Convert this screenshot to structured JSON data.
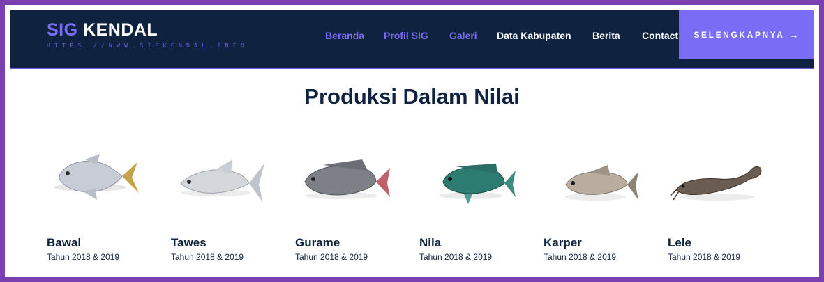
{
  "brand": {
    "title_accent": "SIG",
    "title_rest": "KENDAL",
    "url": "HTTPS://WWW.SIGKENDAL.INFO"
  },
  "nav": {
    "items": [
      {
        "label": "Beranda"
      },
      {
        "label": "Profil SIG"
      },
      {
        "label": "Galeri"
      },
      {
        "label": "Data Kabupaten"
      },
      {
        "label": "Berita"
      },
      {
        "label": "Contact"
      }
    ],
    "cta_label": "SELENGKAPNYA",
    "cta_icon": "arrow-right-icon"
  },
  "colors": {
    "frame": "#7a3fb0",
    "navbar": "#0f2340",
    "accent": "#7b6cf6",
    "text_dark": "#0f2340"
  },
  "main": {
    "heading": "Produksi Dalam Nilai",
    "fish": [
      {
        "name": "Bawal",
        "subtitle": "Tahun 2018 & 2019"
      },
      {
        "name": "Tawes",
        "subtitle": "Tahun 2018 & 2019"
      },
      {
        "name": "Gurame",
        "subtitle": "Tahun 2018 & 2019"
      },
      {
        "name": "Nila",
        "subtitle": "Tahun 2018 & 2019"
      },
      {
        "name": "Karper",
        "subtitle": "Tahun 2018 & 2019"
      },
      {
        "name": "Lele",
        "subtitle": "Tahun 2018 & 2019"
      }
    ]
  }
}
